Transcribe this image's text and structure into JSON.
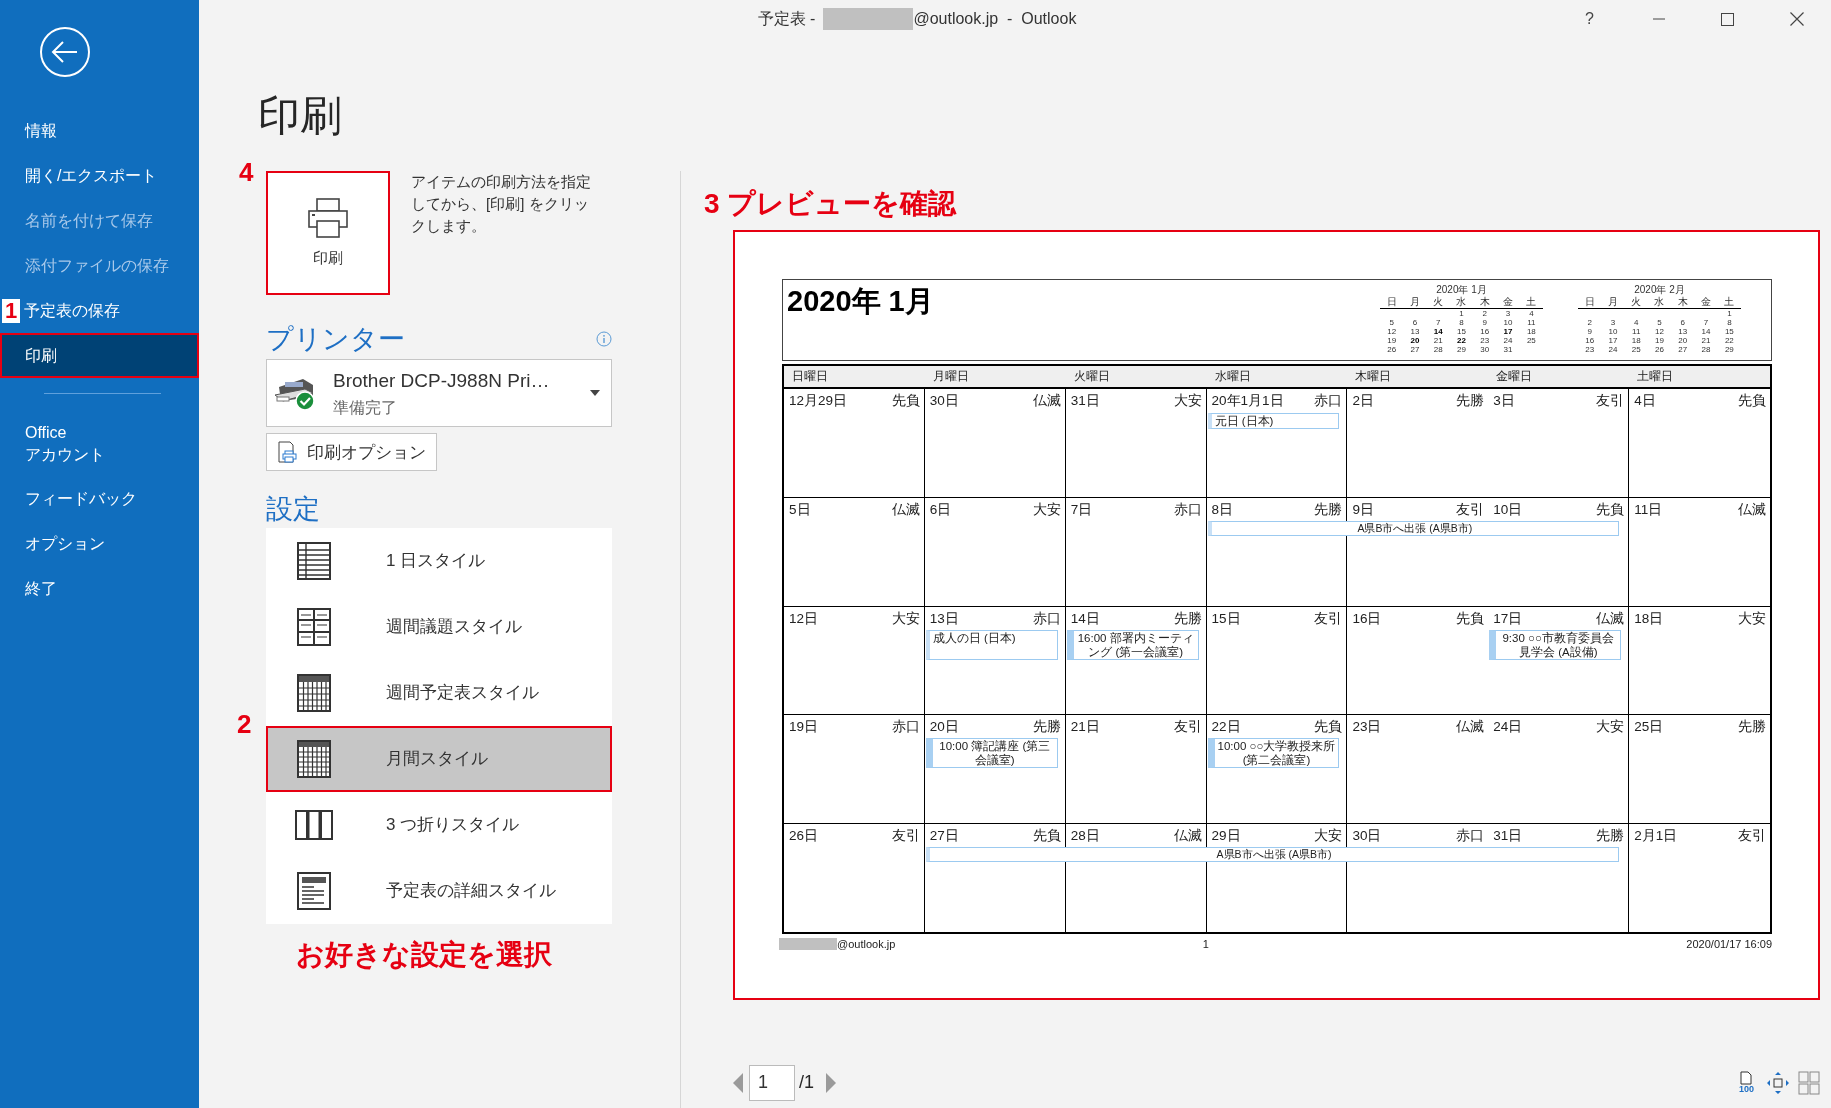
{
  "window": {
    "title_prefix": "予定表 -",
    "title_suffix": "@outlook.jp  -  Outlook",
    "help": "?"
  },
  "sidebar": {
    "items": [
      {
        "label": "情報",
        "selected": false,
        "disabled": false,
        "highlighted": false
      },
      {
        "label": "開く/エクスポート",
        "selected": false,
        "disabled": false,
        "highlighted": false
      },
      {
        "label": "名前を付けて保存",
        "selected": false,
        "disabled": true,
        "highlighted": false
      },
      {
        "label": "添付ファイルの保存",
        "selected": false,
        "disabled": true,
        "highlighted": false
      },
      {
        "label": "予定表の保存",
        "selected": false,
        "disabled": false,
        "highlighted": false,
        "step": "1"
      },
      {
        "label": "印刷",
        "selected": true,
        "disabled": false,
        "highlighted": true
      }
    ],
    "lower_items": [
      {
        "label": "Office\nアカウント",
        "selected": false,
        "disabled": false,
        "highlighted": false
      },
      {
        "label": "フィードバック",
        "selected": false,
        "disabled": false,
        "highlighted": false
      },
      {
        "label": "オプション",
        "selected": false,
        "disabled": false,
        "highlighted": false
      },
      {
        "label": "終了",
        "selected": false,
        "disabled": false,
        "highlighted": false
      }
    ]
  },
  "page_title": "印刷",
  "print_button": {
    "label": "印刷",
    "highlighted": true,
    "step": "4"
  },
  "print_description": "アイテムの印刷方法を指定してから、[印刷] をクリックします。",
  "printer": {
    "heading": "プリンター",
    "name": "Brother DCP-J988N Pri…",
    "status": "準備完了",
    "options_button": "印刷オプション"
  },
  "settings": {
    "heading": "設定",
    "hint": "お好きな設定を選択",
    "styles": [
      {
        "label": "1 日スタイル",
        "kind": "day",
        "selected": false,
        "highlighted": false
      },
      {
        "label": "週間議題スタイル",
        "kind": "week-agenda",
        "selected": false,
        "highlighted": false
      },
      {
        "label": "週間予定表スタイル",
        "kind": "week-calendar",
        "selected": false,
        "highlighted": false
      },
      {
        "label": "月間スタイル",
        "kind": "month",
        "selected": true,
        "highlighted": true,
        "step": "2"
      },
      {
        "label": "3 つ折りスタイル",
        "kind": "trifold",
        "selected": false,
        "highlighted": false
      },
      {
        "label": "予定表の詳細スタイル",
        "kind": "details",
        "selected": false,
        "highlighted": false
      }
    ]
  },
  "preview": {
    "step_title": "3 プレビューを確認",
    "highlighted": true,
    "calendar": {
      "title": "2020年 1月",
      "mini_months": [
        {
          "title": "2020年 1月",
          "weekdays": [
            "日",
            "月",
            "火",
            "水",
            "木",
            "金",
            "土"
          ],
          "weeks": [
            [
              {
                "d": "1",
                "bold": false
              },
              {
                "d": "2",
                "bold": false
              },
              {
                "d": "3",
                "bold": false
              },
              {
                "d": "4",
                "bold": false
              }
            ],
            [
              {
                "d": "5",
                "bold": false
              },
              {
                "d": "6",
                "bold": false
              },
              {
                "d": "7",
                "bold": false
              },
              {
                "d": "8",
                "bold": false
              },
              {
                "d": "9",
                "bold": false
              },
              {
                "d": "10",
                "bold": false
              },
              {
                "d": "11",
                "bold": false
              }
            ],
            [
              {
                "d": "12",
                "bold": false
              },
              {
                "d": "13",
                "bold": false
              },
              {
                "d": "14",
                "bold": true
              },
              {
                "d": "15",
                "bold": false
              },
              {
                "d": "16",
                "bold": false
              },
              {
                "d": "17",
                "bold": true
              },
              {
                "d": "18",
                "bold": false
              }
            ],
            [
              {
                "d": "19",
                "bold": false
              },
              {
                "d": "20",
                "bold": true
              },
              {
                "d": "21",
                "bold": false
              },
              {
                "d": "22",
                "bold": true
              },
              {
                "d": "23",
                "bold": false
              },
              {
                "d": "24",
                "bold": false
              },
              {
                "d": "25",
                "bold": false
              }
            ],
            [
              {
                "d": "26",
                "bold": false
              },
              {
                "d": "27",
                "bold": false
              },
              {
                "d": "28",
                "bold": false
              },
              {
                "d": "29",
                "bold": false
              },
              {
                "d": "30",
                "bold": false
              },
              {
                "d": "31",
                "bold": false
              }
            ]
          ]
        },
        {
          "title": "2020年 2月",
          "weekdays": [
            "日",
            "月",
            "火",
            "水",
            "木",
            "金",
            "土"
          ],
          "weeks": [
            [
              {
                "d": "1",
                "bold": false
              }
            ],
            [
              {
                "d": "2",
                "bold": false
              },
              {
                "d": "3",
                "bold": false
              },
              {
                "d": "4",
                "bold": false
              },
              {
                "d": "5",
                "bold": false
              },
              {
                "d": "6",
                "bold": false
              },
              {
                "d": "7",
                "bold": false
              },
              {
                "d": "8",
                "bold": false
              }
            ],
            [
              {
                "d": "9",
                "bold": false
              },
              {
                "d": "10",
                "bold": false
              },
              {
                "d": "11",
                "bold": false
              },
              {
                "d": "12",
                "bold": false
              },
              {
                "d": "13",
                "bold": false
              },
              {
                "d": "14",
                "bold": false
              },
              {
                "d": "15",
                "bold": false
              }
            ],
            [
              {
                "d": "16",
                "bold": false
              },
              {
                "d": "17",
                "bold": false
              },
              {
                "d": "18",
                "bold": false
              },
              {
                "d": "19",
                "bold": false
              },
              {
                "d": "20",
                "bold": false
              },
              {
                "d": "21",
                "bold": false
              },
              {
                "d": "22",
                "bold": false
              }
            ],
            [
              {
                "d": "23",
                "bold": false
              },
              {
                "d": "24",
                "bold": false
              },
              {
                "d": "25",
                "bold": false
              },
              {
                "d": "26",
                "bold": false
              },
              {
                "d": "27",
                "bold": false
              },
              {
                "d": "28",
                "bold": false
              },
              {
                "d": "29",
                "bold": false
              }
            ]
          ]
        }
      ],
      "weekdays": [
        "日曜日",
        "月曜日",
        "火曜日",
        "水曜日",
        "木曜日",
        "金曜日",
        "土曜日"
      ],
      "weeks": [
        {
          "days": [
            {
              "date": "12月29日",
              "rokuyo": "先負"
            },
            {
              "date": "30日",
              "rokuyo": "仏滅"
            },
            {
              "date": "31日",
              "rokuyo": "大安"
            },
            {
              "date": "20年1月1日",
              "rokuyo": "赤口",
              "events": [
                {
                  "text": "元日 (日本)",
                  "kind": "allday"
                }
              ]
            },
            {
              "date": "2日",
              "rokuyo": "先勝"
            },
            {
              "date": "3日",
              "rokuyo": "友引"
            },
            {
              "date": "4日",
              "rokuyo": "先負"
            }
          ]
        },
        {
          "days": [
            {
              "date": "5日",
              "rokuyo": "仏滅"
            },
            {
              "date": "6日",
              "rokuyo": "大安"
            },
            {
              "date": "7日",
              "rokuyo": "赤口"
            },
            {
              "date": "8日",
              "rokuyo": "先勝",
              "events": [
                {
                  "text": "A県B市へ出張 (A県B市)",
                  "kind": "allday"
                }
              ]
            },
            {
              "date": "9日",
              "rokuyo": "友引",
              "events": [
                {
                  "kind": "continuation"
                }
              ]
            },
            {
              "date": "10日",
              "rokuyo": "先負",
              "events": [
                {
                  "kind": "continuation"
                }
              ]
            },
            {
              "date": "11日",
              "rokuyo": "仏滅"
            }
          ]
        },
        {
          "days": [
            {
              "date": "12日",
              "rokuyo": "大安"
            },
            {
              "date": "13日",
              "rokuyo": "赤口",
              "events": [
                {
                  "text": "成人の日 (日本)",
                  "kind": "allday"
                }
              ]
            },
            {
              "date": "14日",
              "rokuyo": "先勝",
              "events": [
                {
                  "text": "16:00 部署内ミーティング (第一会議室)",
                  "kind": "timed"
                }
              ]
            },
            {
              "date": "15日",
              "rokuyo": "友引"
            },
            {
              "date": "16日",
              "rokuyo": "先負"
            },
            {
              "date": "17日",
              "rokuyo": "仏滅",
              "events": [
                {
                  "text": "9:30 ○○市教育委員会見学会 (A設備)",
                  "kind": "timed"
                }
              ]
            },
            {
              "date": "18日",
              "rokuyo": "大安"
            }
          ]
        },
        {
          "days": [
            {
              "date": "19日",
              "rokuyo": "赤口"
            },
            {
              "date": "20日",
              "rokuyo": "先勝",
              "events": [
                {
                  "text": "10:00 簿記講座 (第三会議室)",
                  "kind": "timed"
                }
              ]
            },
            {
              "date": "21日",
              "rokuyo": "友引"
            },
            {
              "date": "22日",
              "rokuyo": "先負",
              "events": [
                {
                  "text": "10:00 ○○大学教授来所 (第二会議室)",
                  "kind": "timed"
                }
              ]
            },
            {
              "date": "23日",
              "rokuyo": "仏滅"
            },
            {
              "date": "24日",
              "rokuyo": "大安"
            },
            {
              "date": "25日",
              "rokuyo": "先勝"
            }
          ]
        },
        {
          "days": [
            {
              "date": "26日",
              "rokuyo": "友引"
            },
            {
              "date": "27日",
              "rokuyo": "先負",
              "events": [
                {
                  "text": "A県B市へ出張 (A県B市)",
                  "kind": "allday"
                }
              ]
            },
            {
              "date": "28日",
              "rokuyo": "仏滅",
              "events": [
                {
                  "kind": "continuation"
                }
              ]
            },
            {
              "date": "29日",
              "rokuyo": "大安",
              "events": [
                {
                  "kind": "continuation"
                }
              ]
            },
            {
              "date": "30日",
              "rokuyo": "赤口",
              "events": [
                {
                  "kind": "continuation"
                }
              ]
            },
            {
              "date": "31日",
              "rokuyo": "先勝",
              "events": [
                {
                  "kind": "continuation"
                }
              ]
            },
            {
              "date": "2月1日",
              "rokuyo": "友引"
            }
          ]
        }
      ]
    },
    "footer": {
      "account_suffix": "@outlook.jp",
      "page": "1",
      "printed_at": "2020/01/17 16:09"
    }
  },
  "pager": {
    "page": "1",
    "total": "/1",
    "zoom": "100"
  }
}
